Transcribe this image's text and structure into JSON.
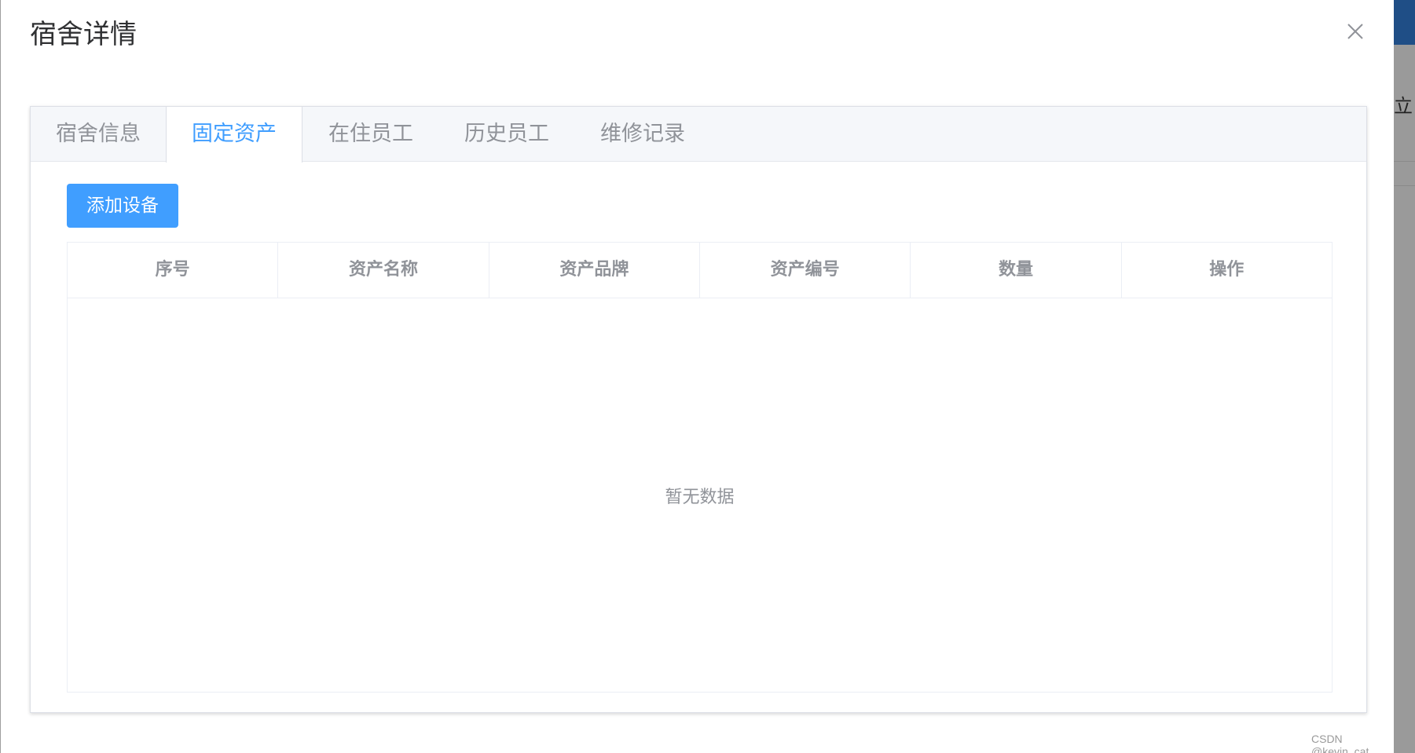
{
  "dialog": {
    "title": "宿舍详情"
  },
  "tabs": [
    {
      "label": "宿舍信息",
      "active": false
    },
    {
      "label": "固定资产",
      "active": true
    },
    {
      "label": "在住员工",
      "active": false
    },
    {
      "label": "历史员工",
      "active": false
    },
    {
      "label": "维修记录",
      "active": false
    }
  ],
  "toolbar": {
    "add_label": "添加设备"
  },
  "table": {
    "columns": [
      "序号",
      "资产名称",
      "资产品牌",
      "资产编号",
      "数量",
      "操作"
    ],
    "empty_text": "暂无数据"
  },
  "background": {
    "partial_char": "立"
  },
  "watermark": "CSDN @kevin_cat",
  "colors": {
    "accent": "#409eff",
    "tab_header_bg": "#f5f7fa",
    "muted_text": "#909399"
  }
}
